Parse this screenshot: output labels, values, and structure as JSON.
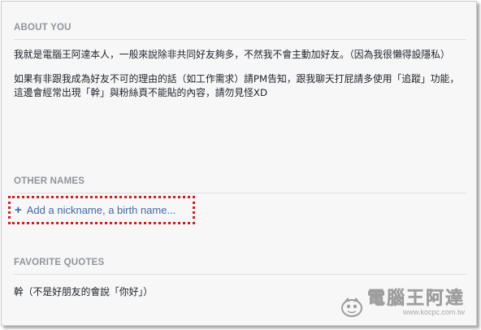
{
  "about": {
    "title": "ABOUT YOU",
    "paragraph1": "我就是電腦王阿達本人，一般來說除非共同好友夠多，不然我不會主動加好友。（因為我很懶得設隱私）",
    "paragraph2": "如果有非跟我成為好友不可的理由的話（如工作需求）請PM告知，跟我聊天打屁請多使用「追蹤」功能，這邊會經常出現「幹」與粉絲頁不能貼的內容，請勿見怪XD"
  },
  "other_names": {
    "title": "OTHER NAMES",
    "add_label": "Add a nickname, a birth name..."
  },
  "quotes": {
    "title": "FAVORITE QUOTES",
    "text": "幹（不是好朋友的會說「你好」）"
  },
  "watermark": {
    "name": "電腦王阿達",
    "url": "www.kocpc.com.tw"
  },
  "colors": {
    "link": "#4267b2",
    "highlight_border": "#e0191e",
    "section_title": "#90949c"
  }
}
